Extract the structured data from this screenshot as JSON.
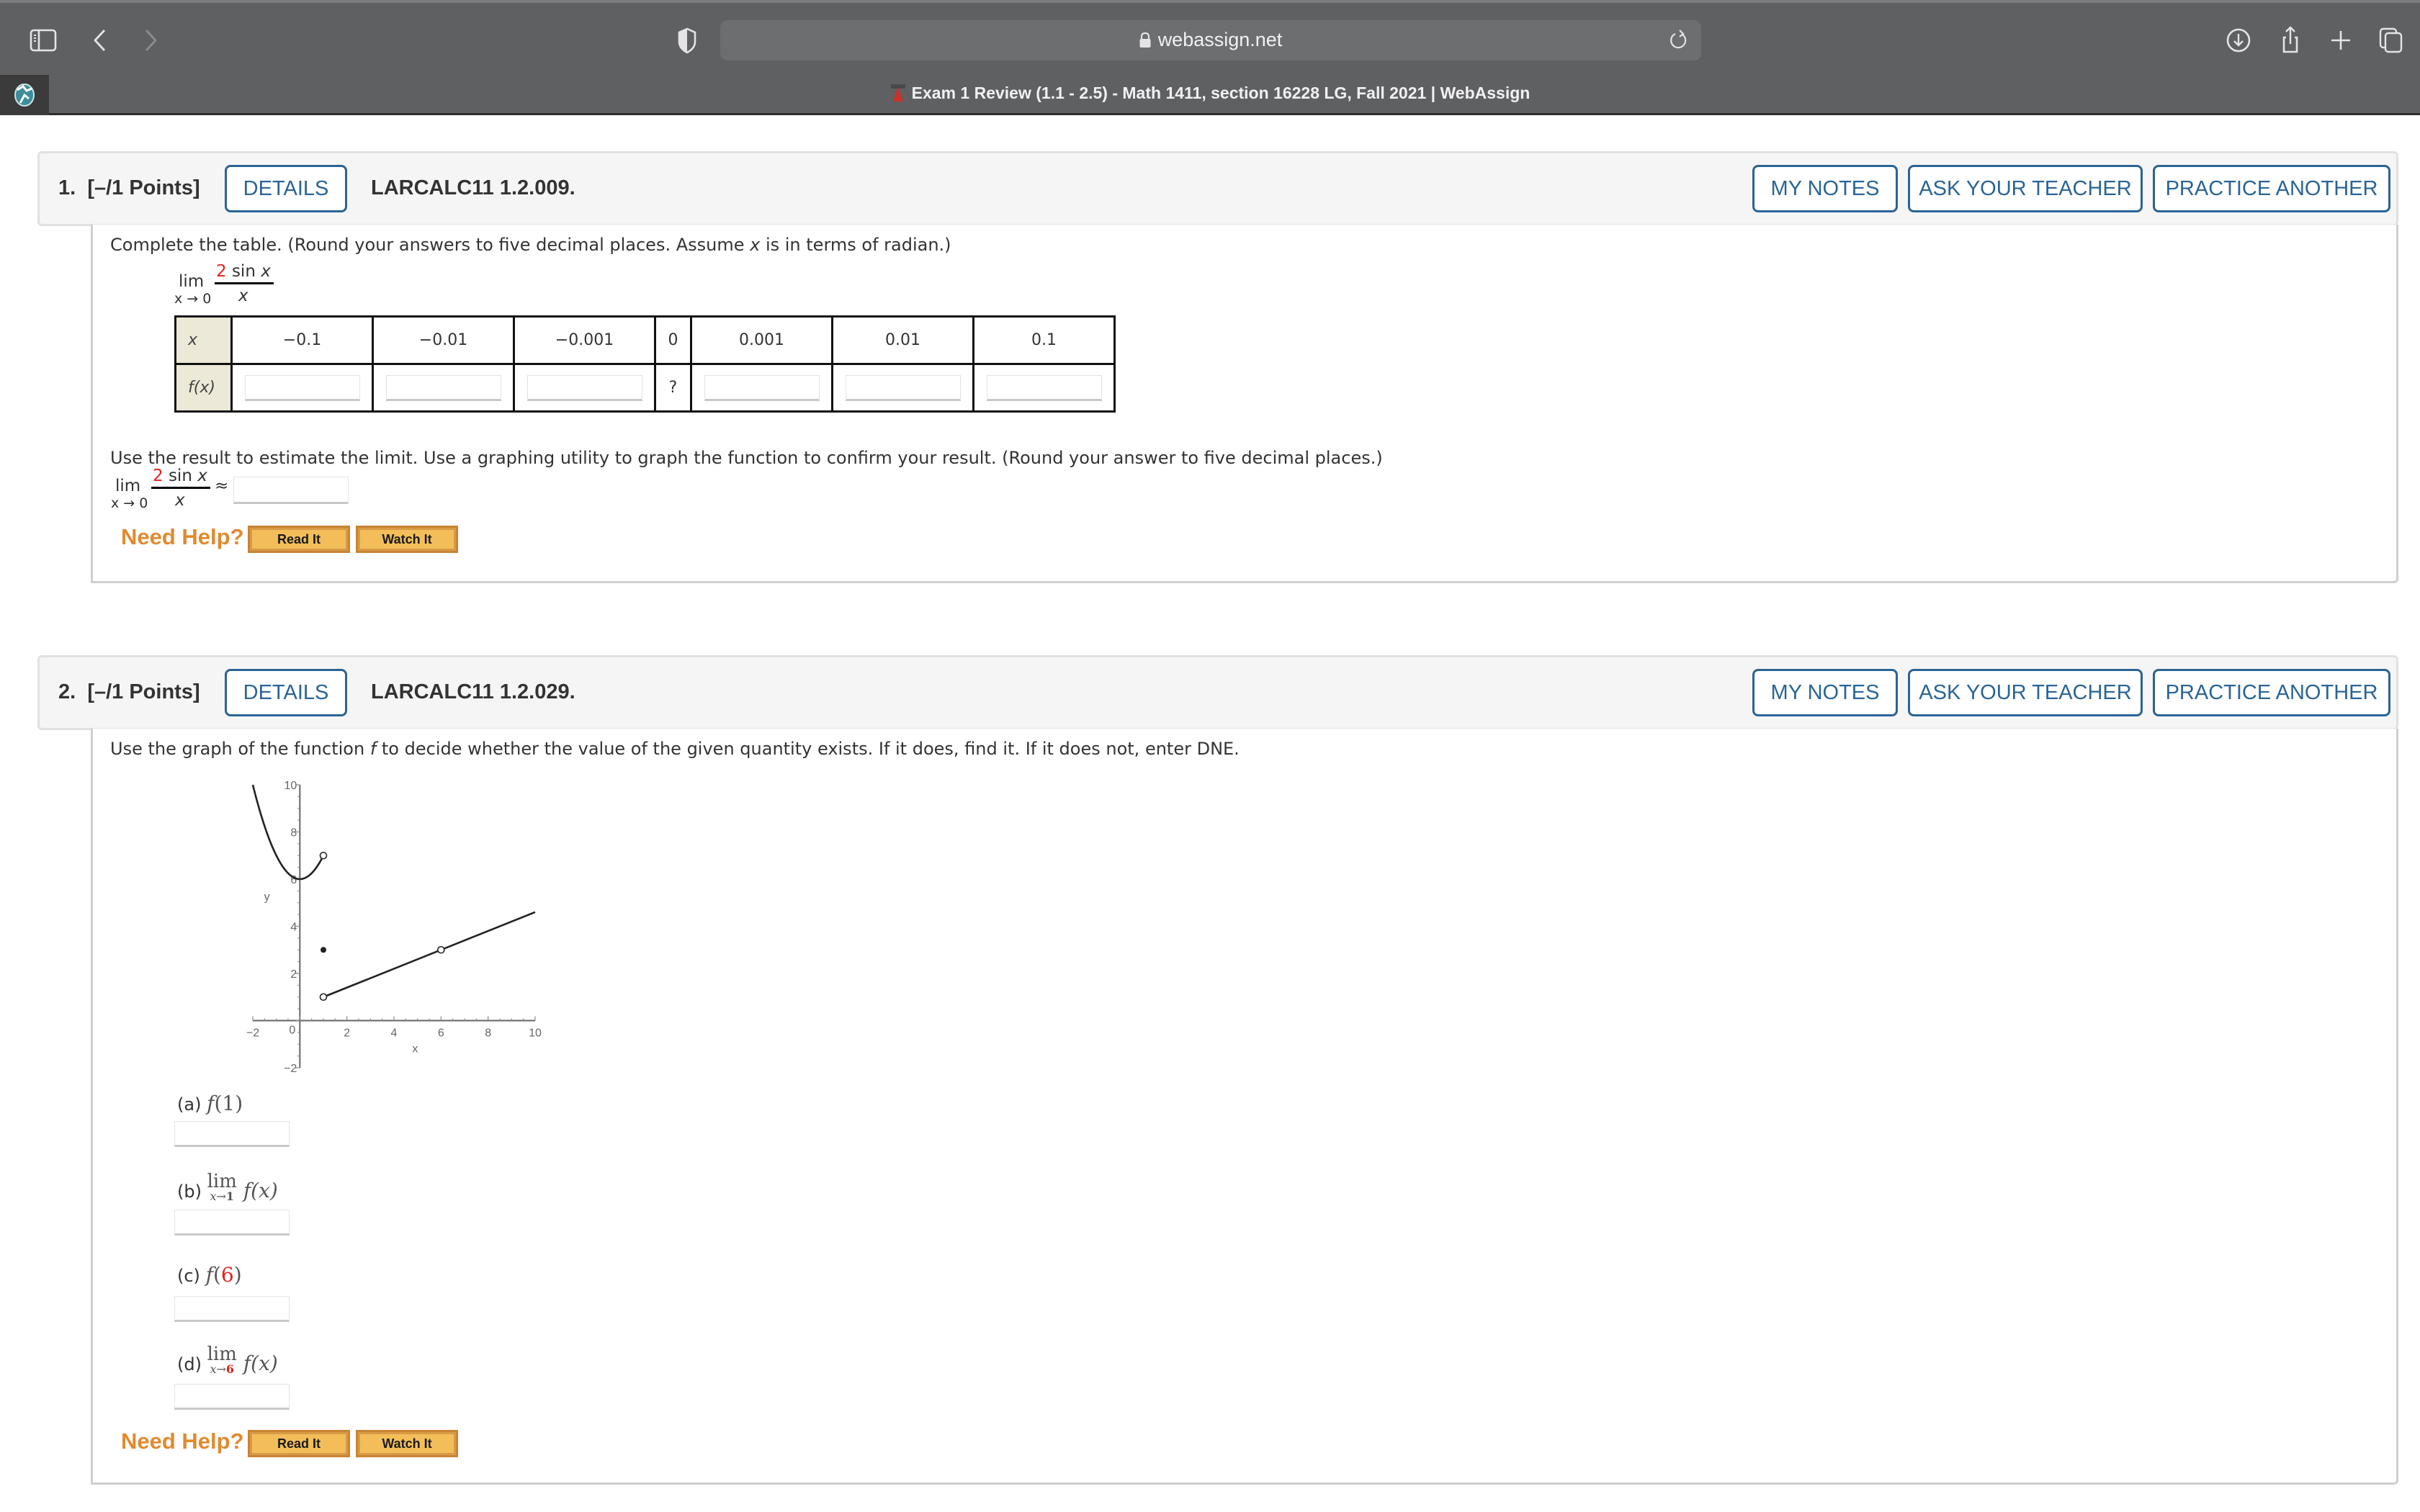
{
  "browser": {
    "url": "webassign.net",
    "tab_title": "Exam 1 Review (1.1 - 2.5) - Math 1411, section 16228 LG, Fall 2021 | WebAssign",
    "toolbar_icons": [
      "sidebar-icon",
      "back-icon",
      "forward-icon",
      "privacy-shield-icon",
      "lock-icon",
      "reload-icon",
      "download-icon",
      "share-icon",
      "new-tab-icon",
      "tab-overview-icon"
    ]
  },
  "questions": [
    {
      "number": "1.",
      "points": "[–/1 Points]",
      "details_label": "DETAILS",
      "reference": "LARCALC11 1.2.009.",
      "my_notes_label": "MY NOTES",
      "ask_teacher_label": "ASK YOUR TEACHER",
      "practice_label": "PRACTICE ANOTHER",
      "prompt_pre": "Complete the table. (Round your answers to five decimal places. Assume ",
      "prompt_var": "x",
      "prompt_post": " is in terms of radian.)",
      "limit": {
        "lim": "lim",
        "sub": "x → 0",
        "num_coef": "2",
        "num_rest": " sin ",
        "num_var": "x",
        "den": "x"
      },
      "table": {
        "row1_header": "x",
        "row2_header": "f(x)",
        "x_values": [
          "−0.1",
          "−0.01",
          "−0.001",
          "0",
          "0.001",
          "0.01",
          "0.1"
        ],
        "f_values": [
          "",
          "",
          "",
          "?",
          "",
          "",
          ""
        ]
      },
      "prompt2": "Use the result to estimate the limit. Use a graphing utility to graph the function to confirm your result. (Round your answer to five decimal places.)",
      "approx_symbol": "≈",
      "approx_value": "",
      "need_help": "Need Help?",
      "read_it": "Read It",
      "watch_it": "Watch It"
    },
    {
      "number": "2.",
      "points": "[–/1 Points]",
      "details_label": "DETAILS",
      "reference": "LARCALC11 1.2.029.",
      "my_notes_label": "MY NOTES",
      "ask_teacher_label": "ASK YOUR TEACHER",
      "practice_label": "PRACTICE ANOTHER",
      "prompt_pre": "Use the graph of the function ",
      "prompt_var": "f",
      "prompt_post": " to decide whether the value of the given quantity exists. If it does, find it. If it does not, enter DNE.",
      "parts": [
        {
          "label": "(a)",
          "fn": "f",
          "arg": "1",
          "arg_red": false,
          "value": ""
        },
        {
          "label": "(b)",
          "lim": "lim",
          "sub_var": "x→",
          "sub_val": "1",
          "sub_red": false,
          "expr": "f(x)",
          "value": ""
        },
        {
          "label": "(c)",
          "fn": "f",
          "arg": "6",
          "arg_red": true,
          "value": ""
        },
        {
          "label": "(d)",
          "lim": "lim",
          "sub_var": "x→",
          "sub_val": "6",
          "sub_red": true,
          "expr": "f(x)",
          "value": ""
        }
      ],
      "need_help": "Need Help?",
      "read_it": "Read It",
      "watch_it": "Watch It"
    }
  ],
  "chart_data": {
    "type": "line",
    "title": "",
    "xlabel": "x",
    "ylabel": "y",
    "xlim": [
      -2,
      10
    ],
    "ylim": [
      -2,
      10
    ],
    "x_ticks": [
      -2,
      0,
      2,
      4,
      6,
      8,
      10
    ],
    "y_ticks": [
      -2,
      2,
      4,
      6,
      8,
      10
    ],
    "origin_label": "0",
    "grid": false,
    "series": [
      {
        "name": "parabola",
        "kind": "curve",
        "formula": "y = x^2 + 6",
        "x_range": [
          -2,
          1
        ],
        "points": [
          [
            -2,
            10
          ],
          [
            -1.5,
            8.25
          ],
          [
            -1,
            7
          ],
          [
            -0.5,
            6.25
          ],
          [
            0,
            6
          ],
          [
            0.5,
            6.25
          ],
          [
            1,
            7
          ]
        ]
      },
      {
        "name": "line",
        "kind": "segment",
        "points": [
          [
            1,
            1
          ],
          [
            10,
            4.6
          ]
        ]
      }
    ],
    "open_points": [
      [
        1,
        7
      ],
      [
        1,
        1
      ],
      [
        6,
        3
      ]
    ],
    "closed_points": [
      [
        1,
        3
      ]
    ]
  }
}
